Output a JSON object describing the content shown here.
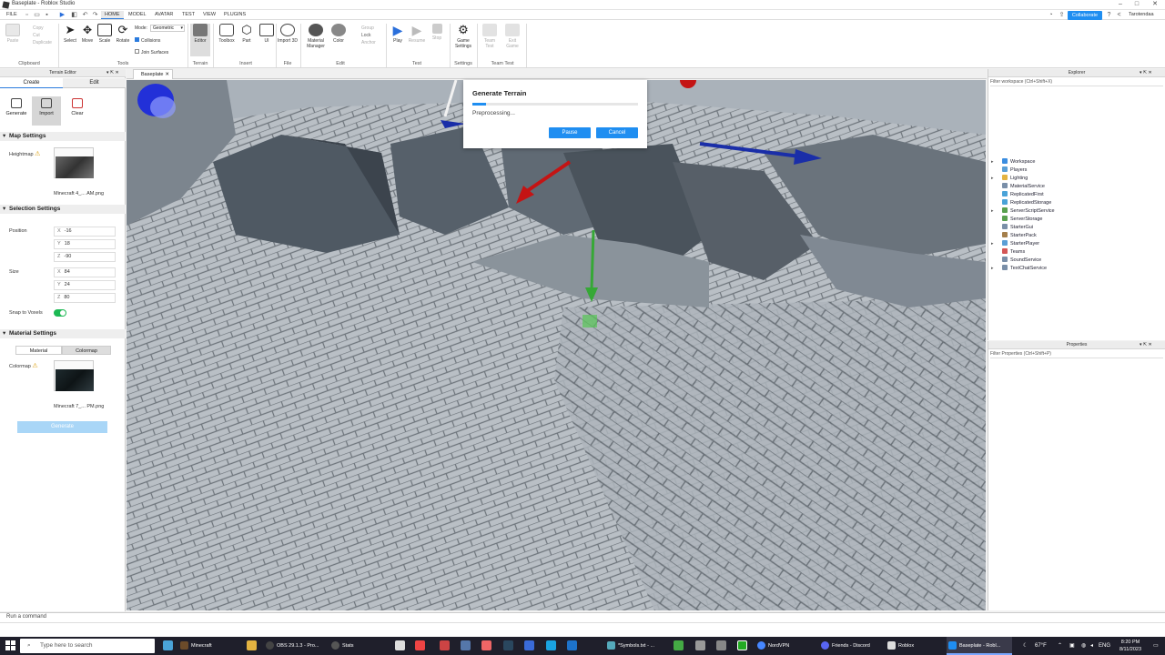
{
  "window": {
    "title": "Baseplate - Roblox Studio",
    "user": "Tarotendaa"
  },
  "menubar": {
    "items": [
      "FILE",
      "HOME",
      "MODEL",
      "AVATAR",
      "TEST",
      "VIEW",
      "PLUGINS"
    ],
    "active": "HOME",
    "collaborate": "Collaborate"
  },
  "ribbon": {
    "clipboard": {
      "label": "Clipboard",
      "paste": "Paste",
      "copy": "Copy",
      "cut": "Cut",
      "duplicate": "Duplicate"
    },
    "tools": {
      "label": "Tools",
      "select": "Select",
      "move": "Move",
      "scale": "Scale",
      "rotate": "Rotate",
      "mode_label": "Mode:",
      "mode_value": "Geometric",
      "collisions": "Collisions",
      "join_surfaces": "Join Surfaces"
    },
    "terrain": {
      "label": "Terrain",
      "editor": "Editor"
    },
    "insert": {
      "label": "Insert",
      "toolbox": "Toolbox",
      "part": "Part",
      "ui": "UI"
    },
    "file": {
      "label": "File",
      "import3d": "Import 3D"
    },
    "edit": {
      "label": "Edit",
      "material_manager": "Material Manager",
      "color": "Color",
      "group": "Group",
      "lock": "Lock",
      "anchor": "Anchor"
    },
    "test": {
      "label": "Test",
      "play": "Play",
      "resume": "Resume",
      "stop": "Stop"
    },
    "settings": {
      "label": "Settings",
      "game_settings": "Game Settings"
    },
    "team_test": {
      "label": "Team Test",
      "team_test": "Team Test",
      "exit_game": "Exit Game"
    }
  },
  "terrain_editor": {
    "title": "Terrain Editor",
    "tabs": [
      "Create",
      "Edit"
    ],
    "modes": [
      "Generate",
      "Import",
      "Clear"
    ],
    "map_settings": {
      "title": "Map Settings",
      "heightmap_label": "Heightmap",
      "heightmap_file": "Minecraft 4_... AM.png"
    },
    "selection_settings": {
      "title": "Selection Settings",
      "position_label": "Position",
      "position": {
        "x": "-16",
        "y": "18",
        "z": "-90"
      },
      "size_label": "Size",
      "size": {
        "x": "84",
        "y": "24",
        "z": "80"
      },
      "snap_label": "Snap to Voxels",
      "snap_on": true
    },
    "material_settings": {
      "title": "Material Settings",
      "tabs": [
        "Material",
        "Colormap"
      ],
      "colormap_label": "Colormap",
      "colormap_file": "Minecraft 7_... PM.png"
    },
    "generate_button": "Generate"
  },
  "document_tab": "Baseplate",
  "dialog": {
    "title": "Generate Terrain",
    "status": "Preprocessing...",
    "progress": 0.08,
    "pause": "Pause",
    "cancel": "Cancel"
  },
  "explorer": {
    "title": "Explorer",
    "filter": "Filter workspace (Ctrl+Shift+X)",
    "items": [
      {
        "name": "Workspace",
        "expandable": true,
        "color": "#3b8de0"
      },
      {
        "name": "Players",
        "expandable": false,
        "color": "#5a9fd6"
      },
      {
        "name": "Lighting",
        "expandable": true,
        "color": "#e3b341"
      },
      {
        "name": "MaterialService",
        "expandable": false,
        "color": "#7a8fa8"
      },
      {
        "name": "ReplicatedFirst",
        "expandable": false,
        "color": "#4aa3d8"
      },
      {
        "name": "ReplicatedStorage",
        "expandable": false,
        "color": "#4aa3d8"
      },
      {
        "name": "ServerScriptService",
        "expandable": true,
        "color": "#59a14f"
      },
      {
        "name": "ServerStorage",
        "expandable": false,
        "color": "#59a14f"
      },
      {
        "name": "StarterGui",
        "expandable": false,
        "color": "#7a8fa8"
      },
      {
        "name": "StarterPack",
        "expandable": false,
        "color": "#a57f4b"
      },
      {
        "name": "StarterPlayer",
        "expandable": true,
        "color": "#5a9fd6"
      },
      {
        "name": "Teams",
        "expandable": false,
        "color": "#d45757"
      },
      {
        "name": "SoundService",
        "expandable": false,
        "color": "#7a8fa8"
      },
      {
        "name": "TextChatService",
        "expandable": true,
        "color": "#7a8fa8"
      }
    ]
  },
  "properties": {
    "title": "Properties",
    "filter": "Filter Properties (Ctrl+Shift+P)"
  },
  "command_bar": {
    "placeholder": "Run a command"
  },
  "taskbar": {
    "search": "Type here to search",
    "apps": [
      "Minecraft",
      "OBS 29.1.3 - Pro...",
      "Stats",
      "*Symbols.txt - ...",
      "NordVPN",
      "Friends - Discord",
      "Roblox",
      "Baseplate - Robl..."
    ],
    "weather": "67°F",
    "language": "ENG",
    "time": "8:20 PM",
    "date": "8/11/2023"
  }
}
